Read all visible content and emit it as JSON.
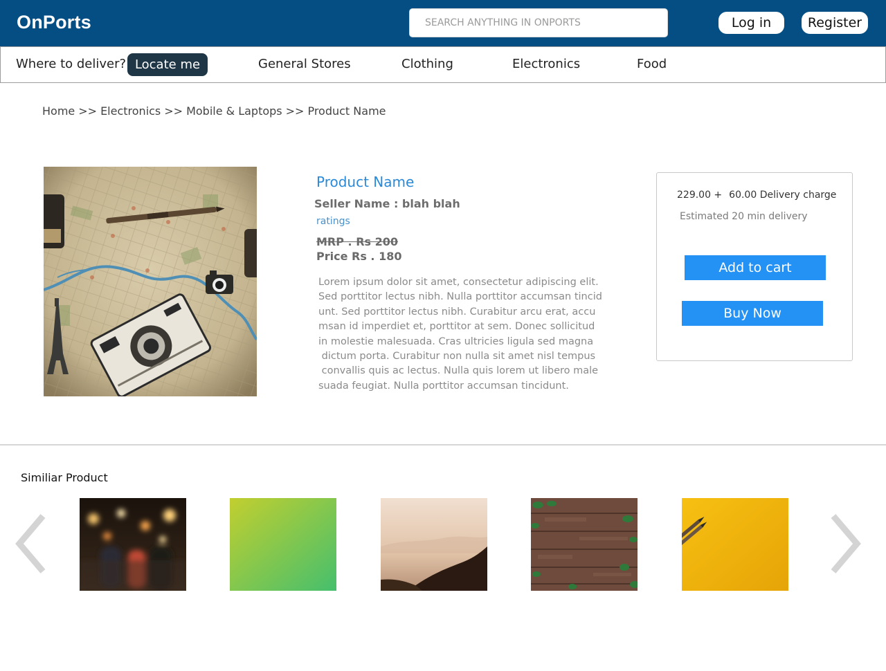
{
  "header": {
    "brand": "OnPorts",
    "search_placeholder": "SEARCH ANYTHING IN ONPORTS",
    "login_label": "Log in",
    "register_label": "Register",
    "brand_color": "#044e83"
  },
  "nav": {
    "deliver_label": "Where to deliver?",
    "locate_label": "Locate me",
    "categories": [
      "General Stores",
      "Clothing",
      "Electronics",
      "Food"
    ]
  },
  "breadcrumb": {
    "items": [
      "Home",
      "Electronics",
      "Mobile & Laptops",
      "Product Name"
    ],
    "separator": ">>"
  },
  "product": {
    "name": "Product Name",
    "seller": "Seller Name : blah blah",
    "ratings": "ratings",
    "mrp": "MRP . Rs 200",
    "price": "Price Rs . 180",
    "description_lines": [
      "Lorem ipsum dolor sit amet, consectetur adipiscing elit.",
      "Sed porttitor lectus nibh. Nulla porttitor accumsan tincid",
      "unt. Sed porttitor lectus nibh. Curabitur arcu erat, accu",
      "msan id imperdiet et, porttitor at sem. Donec sollicitud",
      "in molestie malesuada. Cras ultricies ligula sed magna",
      " dictum porta. Curabitur non nulla sit amet nisl tempus",
      " convallis quis ac lectus. Nulla quis lorem ut libero male",
      "suada feugiat. Nulla porttitor accumsan tincidunt."
    ]
  },
  "buybox": {
    "amount": "229.00 +",
    "delivery_charge": "60.00 Delivery charge",
    "eta": "Estimated 20 min delivery",
    "add_to_cart_label": "Add to cart",
    "buy_now_label": "Buy Now",
    "button_color": "#2491f4"
  },
  "similar": {
    "title": "Similiar Product",
    "thumbnails": [
      "bokeh-street-photo",
      "green-gradient-photo",
      "misty-hills-photo",
      "wooden-wall-leaves-photo",
      "yellow-pencils-photo"
    ]
  }
}
